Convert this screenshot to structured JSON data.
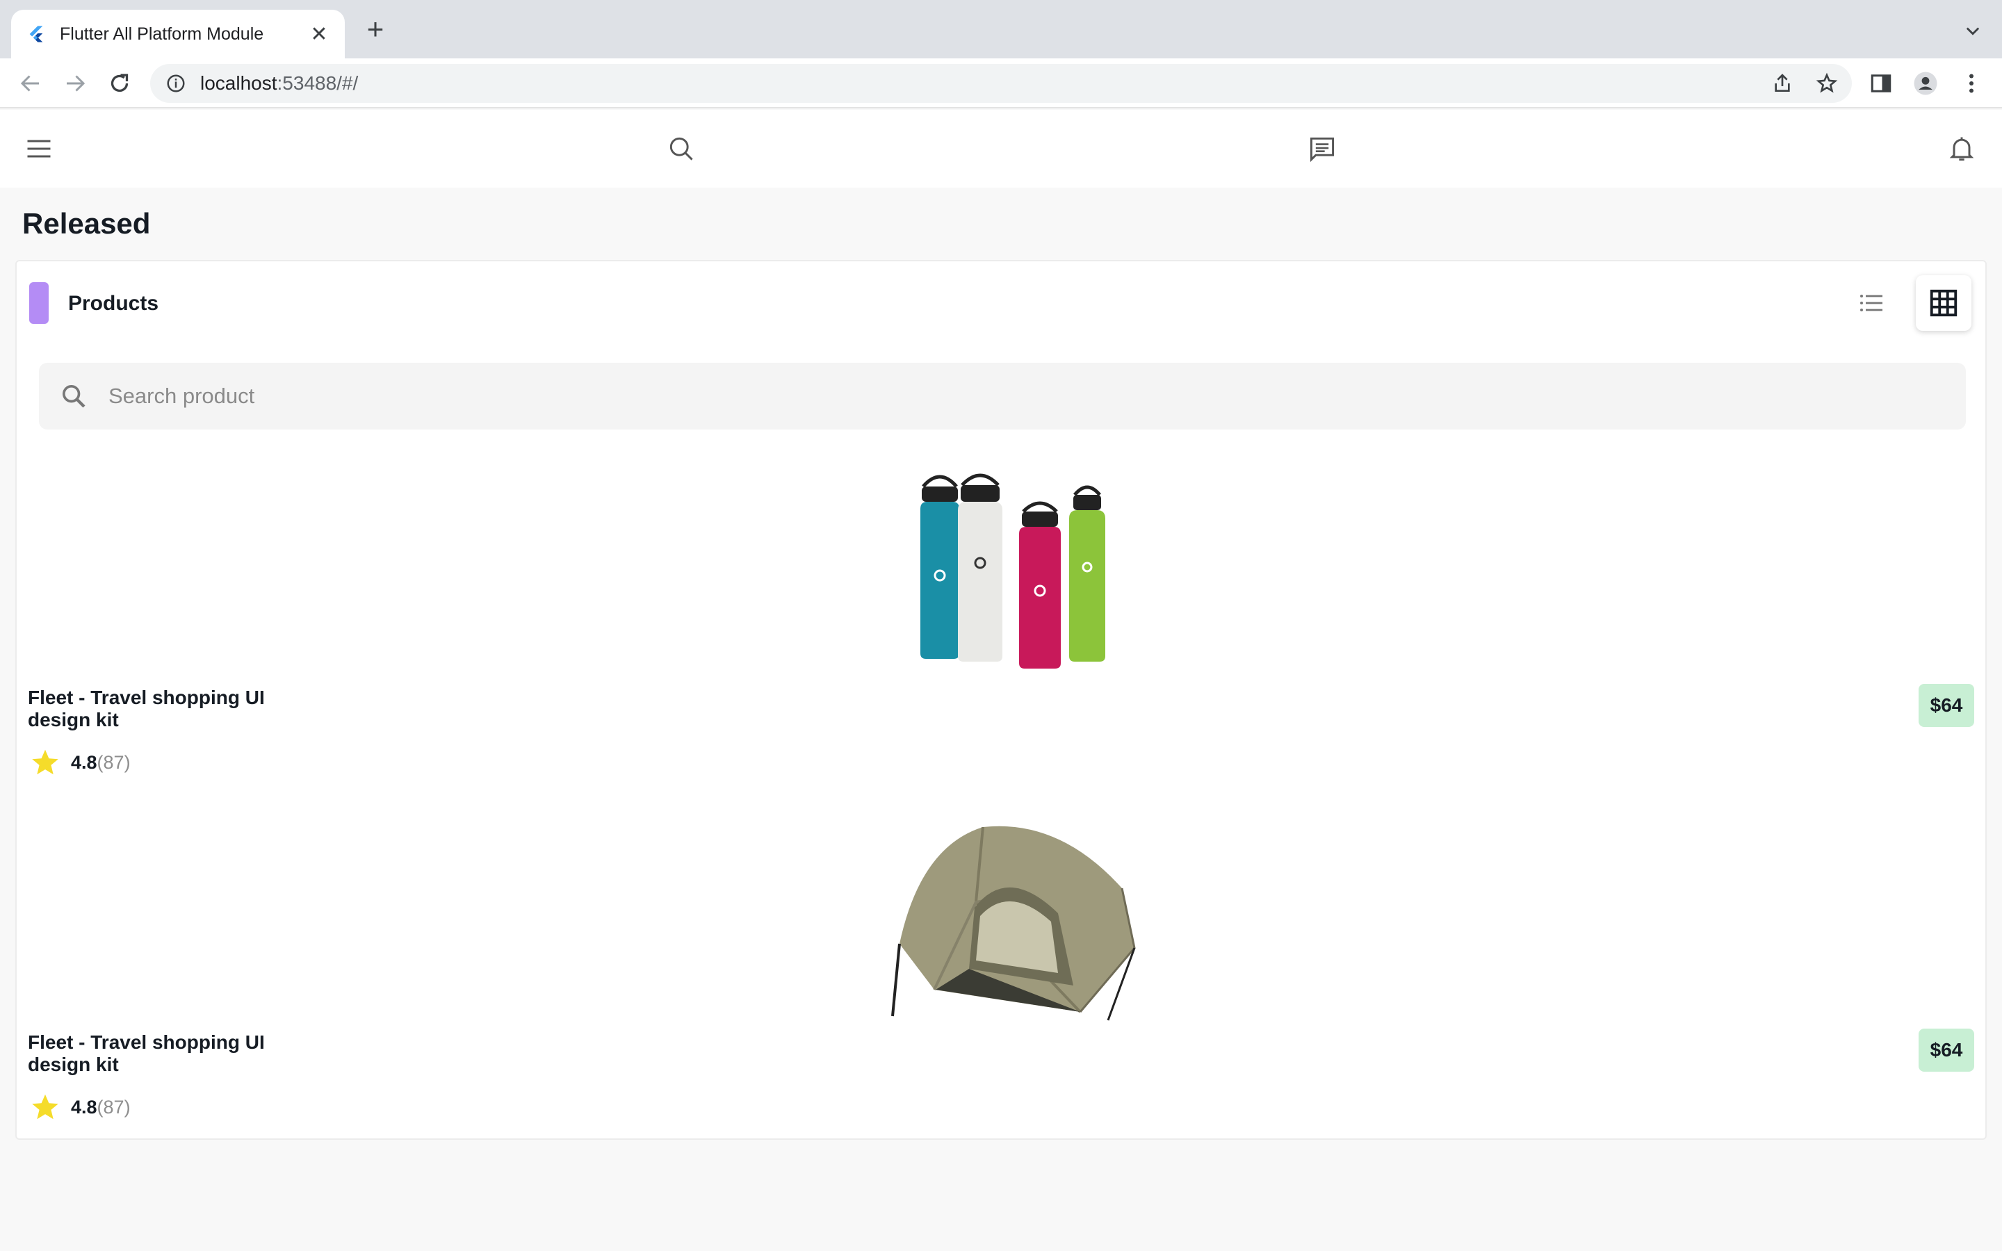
{
  "browser": {
    "tab_title": "Flutter All Platform Module",
    "url_host": "localhost",
    "url_rest": ":53488/#/"
  },
  "appbar": {
    "icons": [
      "menu-icon",
      "search-icon",
      "chat-icon",
      "bell-icon"
    ]
  },
  "page": {
    "title": "Released"
  },
  "card": {
    "title": "Products",
    "accent_color": "#b48cf5",
    "search_placeholder": "Search product",
    "views": [
      "list-view-icon",
      "grid-view-icon"
    ]
  },
  "products": [
    {
      "name": "Fleet - Travel shopping UI design kit",
      "price": "$64",
      "rating": "4.8",
      "reviews": "(87)",
      "image": "water-bottles"
    },
    {
      "name": "Fleet - Travel shopping UI design kit",
      "price": "$64",
      "rating": "4.8",
      "reviews": "(87)",
      "image": "tent"
    }
  ],
  "colors": {
    "price_badge": "#c8efd4",
    "star": "#f5dc2a"
  }
}
